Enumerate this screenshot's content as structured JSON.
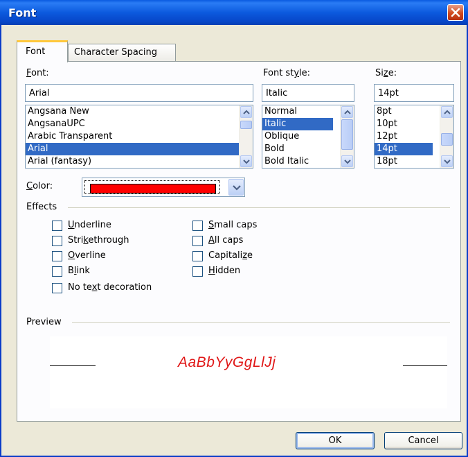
{
  "window": {
    "title": "Font"
  },
  "tabs": [
    {
      "label": "Font",
      "selected": true
    },
    {
      "label": "Character Spacing",
      "selected": false
    }
  ],
  "font": {
    "label_pre": "",
    "label_hot": "F",
    "label_post": "ont:",
    "value": "Arial",
    "items": [
      "Angsana New",
      "AngsanaUPC",
      "Arabic Transparent",
      "Arial",
      "Arial (fantasy)"
    ],
    "selected": "Arial"
  },
  "font_style": {
    "label_pre": "Font st",
    "label_hot": "y",
    "label_post": "le:",
    "value": "Italic",
    "items": [
      "Normal",
      "Italic",
      "Oblique",
      "Bold",
      "Bold Italic"
    ],
    "selected": "Italic"
  },
  "size": {
    "label_pre": "Si",
    "label_hot": "z",
    "label_post": "e:",
    "value": "14pt",
    "items": [
      "8pt",
      "10pt",
      "12pt",
      "14pt",
      "18pt"
    ],
    "selected": "14pt"
  },
  "color": {
    "label_pre": "",
    "label_hot": "C",
    "label_post": "olor:",
    "value": "#ff0000"
  },
  "effects": {
    "title": "Effects",
    "left": [
      {
        "pre": "",
        "hot": "U",
        "post": "nderline"
      },
      {
        "pre": "Stri",
        "hot": "k",
        "post": "ethrough"
      },
      {
        "pre": "",
        "hot": "O",
        "post": "verline"
      },
      {
        "pre": "B",
        "hot": "l",
        "post": "ink"
      },
      {
        "pre": "No te",
        "hot": "x",
        "post": "t decoration"
      }
    ],
    "right": [
      {
        "pre": "",
        "hot": "S",
        "post": "mall caps"
      },
      {
        "pre": "",
        "hot": "A",
        "post": "ll caps"
      },
      {
        "pre": "Capitali",
        "hot": "z",
        "post": "e"
      },
      {
        "pre": "",
        "hot": "H",
        "post": "idden"
      }
    ]
  },
  "preview": {
    "title": "Preview",
    "sample": "AaBbYyGgLlJj",
    "color": "#e01818"
  },
  "buttons": {
    "ok": "OK",
    "cancel": "Cancel"
  },
  "icons": {
    "close": "close-icon",
    "scroll_up": "chevron-up-icon",
    "scroll_down": "chevron-down-icon"
  }
}
